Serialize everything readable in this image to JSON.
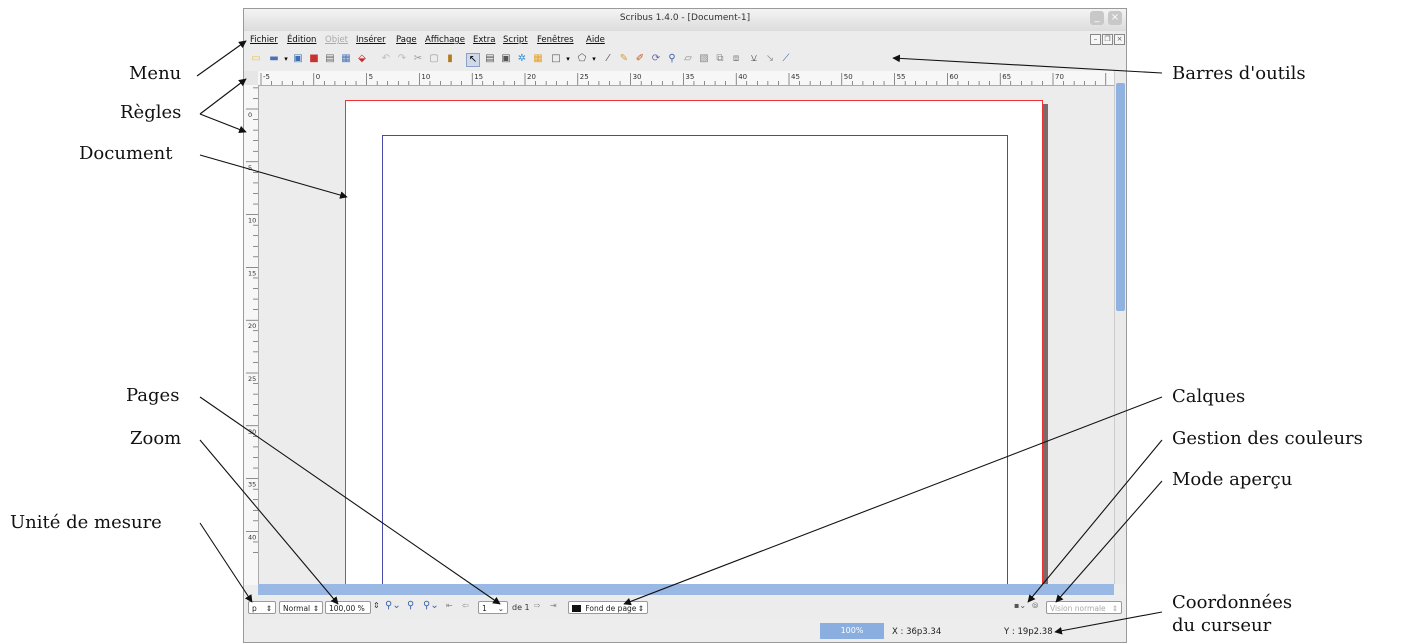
{
  "window": {
    "title": "Scribus 1.4.0 - [Document-1]",
    "min": "_",
    "close": "×"
  },
  "menubar": {
    "items": [
      {
        "label": "Fichier",
        "disabled": false
      },
      {
        "label": "Édition",
        "disabled": false
      },
      {
        "label": "Objet",
        "disabled": true
      },
      {
        "label": "Insérer",
        "disabled": false
      },
      {
        "label": "Page",
        "disabled": false
      },
      {
        "label": "Affichage",
        "disabled": false
      },
      {
        "label": "Extra",
        "disabled": false
      },
      {
        "label": "Script",
        "disabled": false
      },
      {
        "label": "Fenêtres",
        "disabled": false
      },
      {
        "label": "Aide",
        "disabled": false
      }
    ]
  },
  "ruler": {
    "h_labels": [
      "-5",
      "0",
      "5",
      "10",
      "15",
      "20",
      "25",
      "30",
      "35",
      "40",
      "45",
      "50",
      "55",
      "60",
      "65",
      "70"
    ],
    "v_labels": [
      "0",
      "5",
      "10",
      "15",
      "20",
      "25",
      "30",
      "35",
      "40",
      "45"
    ]
  },
  "statusbar": {
    "unit": "p",
    "mode": "Normal",
    "zoom": "100,00 %",
    "page_number": "1",
    "page_of": "de 1",
    "layer": "Fond de page",
    "preview_mode": "Vision normale"
  },
  "coordbar": {
    "zoom": "100%",
    "x": "X : 36p3.34",
    "y": "Y : 19p2.38"
  },
  "annotations": {
    "menu": "Menu",
    "regles": "Règles",
    "document": "Document",
    "pages": "Pages",
    "zoom": "Zoom",
    "unite": "Unité de mesure",
    "barres": "Barres d'outils",
    "calques": "Calques",
    "couleurs": "Gestion des couleurs",
    "apercu": "Mode aperçu",
    "coord1": "Coordonnées",
    "coord2": "du curseur"
  },
  "colors": {
    "page_border": "#ee3333",
    "margin_guide": "#4a4aa8",
    "scroll_accent": "#8fb2e0"
  }
}
